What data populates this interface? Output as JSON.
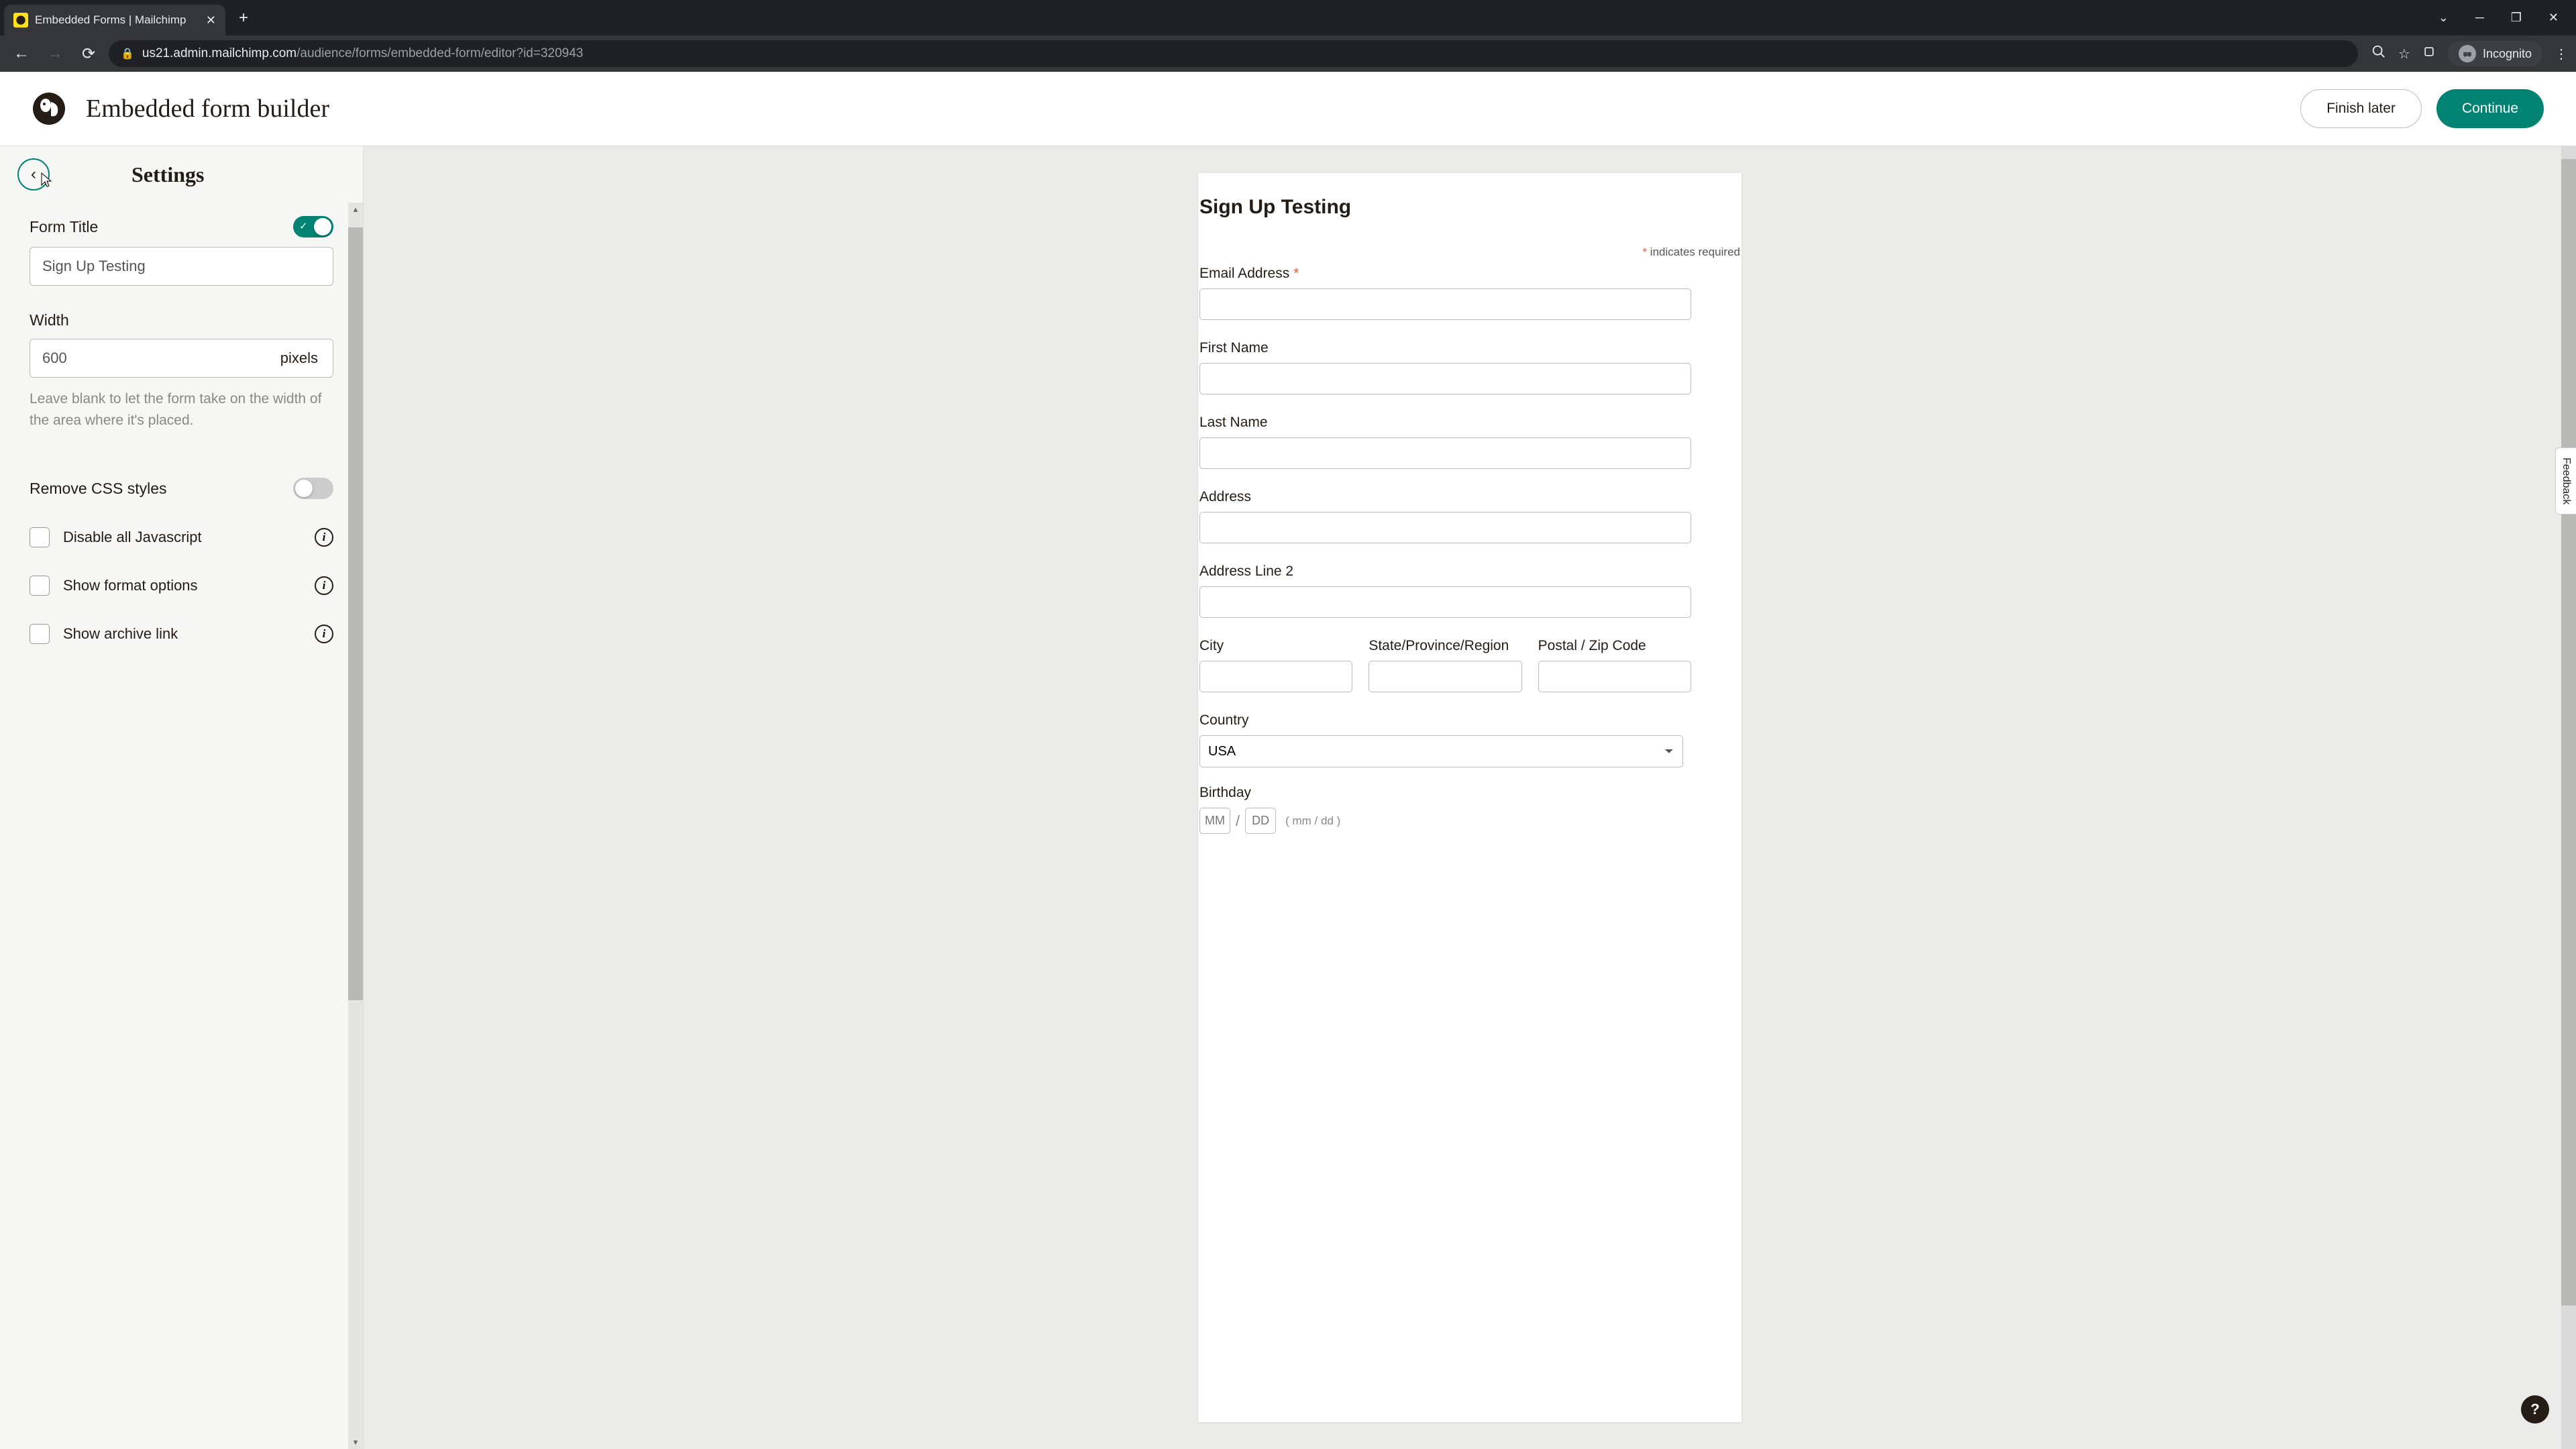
{
  "browser": {
    "tab_title": "Embedded Forms | Mailchimp",
    "url_host": "us21.admin.mailchimp.com",
    "url_path": "/audience/forms/embedded-form/editor?id=320943",
    "incognito_label": "Incognito"
  },
  "header": {
    "title": "Embedded form builder",
    "finish_label": "Finish later",
    "continue_label": "Continue"
  },
  "sidebar": {
    "title": "Settings",
    "form_title_label": "Form Title",
    "form_title_value": "Sign Up Testing",
    "width_label": "Width",
    "width_value": "600",
    "width_suffix": "pixels",
    "width_help": "Leave blank to let the form take on the width of the area where it's placed.",
    "remove_css_label": "Remove CSS styles",
    "checkboxes": [
      {
        "label": "Disable all Javascript"
      },
      {
        "label": "Show format options"
      },
      {
        "label": "Show archive link"
      }
    ]
  },
  "preview": {
    "form_title": "Sign Up Testing",
    "required_note": "indicates required",
    "fields": {
      "email": "Email Address",
      "first_name": "First Name",
      "last_name": "Last Name",
      "address": "Address",
      "address2": "Address Line 2",
      "city": "City",
      "state": "State/Province/Region",
      "postal": "Postal / Zip Code",
      "country": "Country",
      "country_value": "USA",
      "birthday": "Birthday",
      "birthday_mm": "MM",
      "birthday_dd": "DD",
      "birthday_hint": "( mm / dd )"
    }
  },
  "feedback_label": "Feedback"
}
